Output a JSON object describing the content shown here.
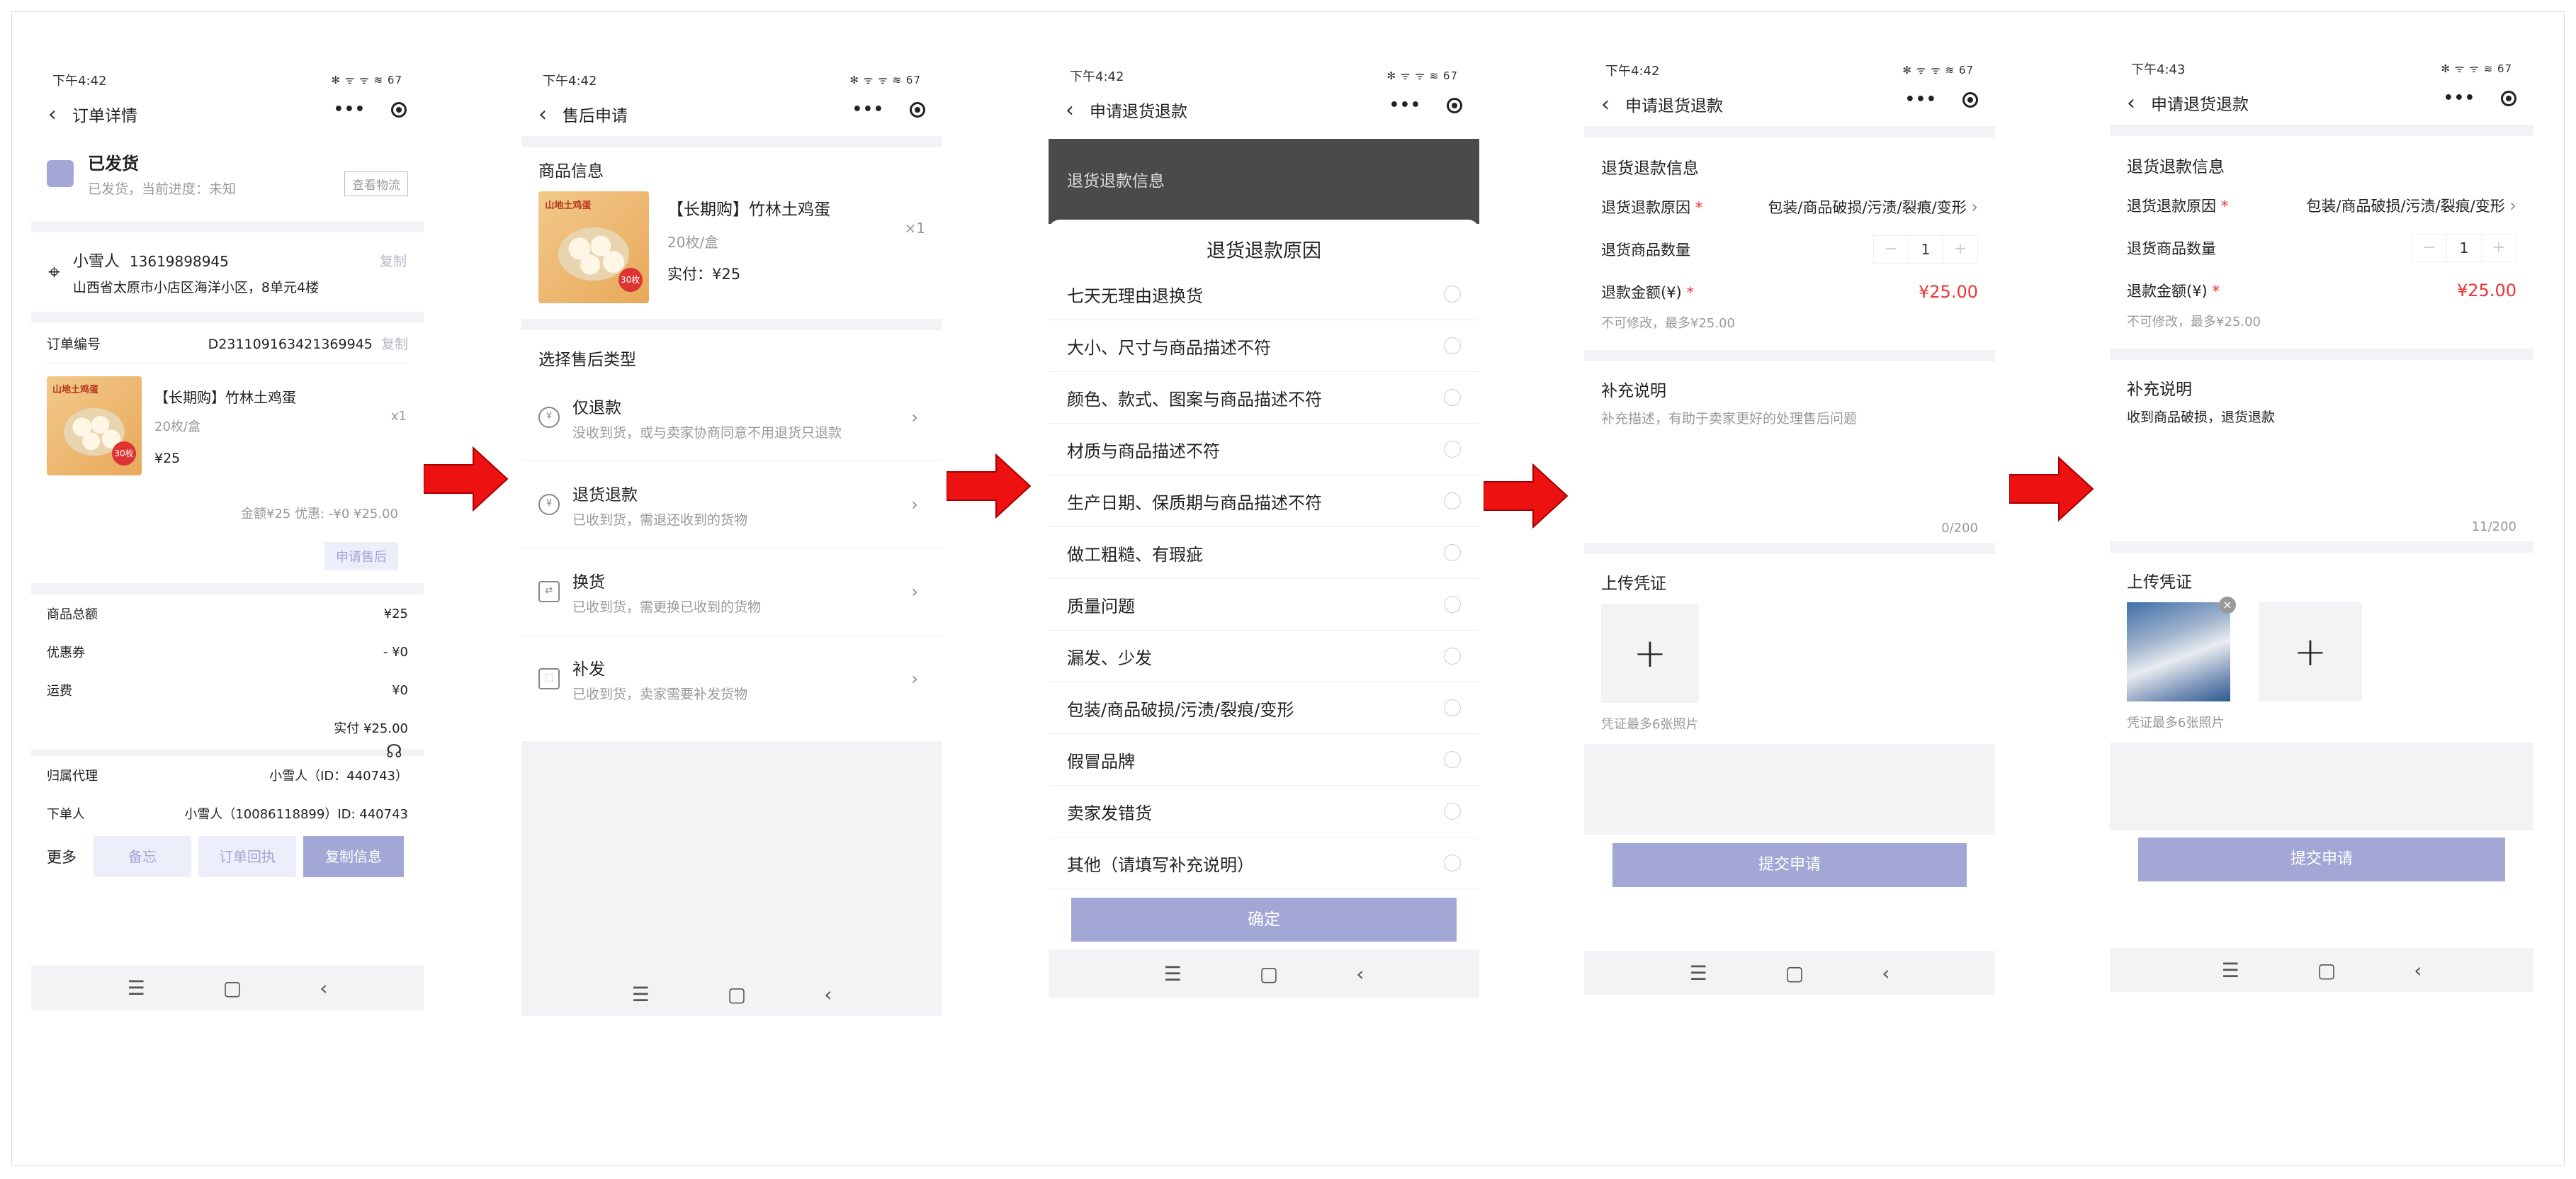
{
  "status_bar": {
    "time_1": "下午4:42",
    "time_2": "下午4:42",
    "time_3": "下午4:42",
    "time_4": "下午4:42",
    "time_5": "下午4:43",
    "right": "✻ ᯤ ᯤ ≋ 67"
  },
  "screen1": {
    "title": "订单详情",
    "status_title": "已发货",
    "status_sub": "已发货，当前进度：未知",
    "logistics_btn": "查看物流",
    "recipient_name": "小雪人",
    "recipient_phone": "13619898945",
    "copy_label": "复制",
    "address": "山西省太原市小店区海洋小区，8单元4楼",
    "order_no_label": "订单编号",
    "order_no": "D231109163421369945",
    "product_name": "【长期购】竹林土鸡蛋",
    "product_spec": "20枚/盒",
    "product_qty": "x1",
    "product_price": "¥25",
    "summary": "金额¥25  优惠: -¥0  ¥25.00",
    "aftersale_btn": "申请售后",
    "total_label": "商品总额",
    "total_value": "¥25",
    "coupon_label": "优惠券",
    "coupon_value": "- ¥0",
    "shipping_label": "运费",
    "shipping_value": "¥0",
    "paid": "实付 ¥25.00",
    "agent_label": "归属代理",
    "agent_value": "小雪人（ID：440743）",
    "orderer_label": "下单人",
    "orderer_value": "小雪人（10086118899）ID: 440743",
    "more": "更多",
    "note_btn": "备忘",
    "receipt_btn": "订单回执",
    "copy_info_btn": "复制信息"
  },
  "screen2": {
    "title": "售后申请",
    "goods_header": "商品信息",
    "product_name": "【长期购】竹林土鸡蛋",
    "product_spec": "20枚/盒",
    "product_qty": "×1",
    "product_paid": "实付：¥25",
    "type_header": "选择售后类型",
    "types": [
      {
        "label": "仅退款",
        "desc": "没收到货，或与卖家协商同意不用退货只退款"
      },
      {
        "label": "退货退款",
        "desc": "已收到货，需退还收到的货物"
      },
      {
        "label": "换货",
        "desc": "已收到货，需更换已收到的货物"
      },
      {
        "label": "补发",
        "desc": "已收到货，卖家需要补发货物"
      }
    ]
  },
  "screen3": {
    "title": "申请退货退款",
    "dim_header": "退货退款信息",
    "sheet_title": "退货退款原因",
    "reasons": [
      "七天无理由退换货",
      "大小、尺寸与商品描述不符",
      "颜色、款式、图案与商品描述不符",
      "材质与商品描述不符",
      "生产日期、保质期与商品描述不符",
      "做工粗糙、有瑕疵",
      "质量问题",
      "漏发、少发",
      "包装/商品破损/污渍/裂痕/变形",
      "假冒品牌",
      "卖家发错货",
      "其他（请填写补充说明）"
    ],
    "confirm": "确定"
  },
  "screen4": {
    "title": "申请退货退款",
    "info_header": "退货退款信息",
    "reason_label": "退货退款原因",
    "reason_value": "包装/商品破损/污渍/裂痕/变形",
    "qty_label": "退货商品数量",
    "qty": "1",
    "amount_label": "退款金额(¥)",
    "amount": "¥25.00",
    "amount_note": "不可修改，最多¥25.00",
    "supplement_header": "补充说明",
    "supplement_placeholder": "补充描述，有助于卖家更好的处理售后问题",
    "counter": "0/200",
    "upload_header": "上传凭证",
    "upload_note": "凭证最多6张照片",
    "submit": "提交申请"
  },
  "screen5": {
    "title": "申请退货退款",
    "info_header": "退货退款信息",
    "reason_label": "退货退款原因",
    "reason_value": "包装/商品破损/污渍/裂痕/变形",
    "qty_label": "退货商品数量",
    "qty": "1",
    "amount_label": "退款金额(¥)",
    "amount": "¥25.00",
    "amount_note": "不可修改，最多¥25.00",
    "supplement_header": "补充说明",
    "supplement_text": "收到商品破损，退货退款",
    "counter": "11/200",
    "upload_header": "上传凭证",
    "upload_note": "凭证最多6张照片",
    "submit": "提交申请"
  },
  "colors": {
    "arrow": "#ee1111",
    "lavender": "#a3a7d6",
    "price_red": "#e33333"
  }
}
